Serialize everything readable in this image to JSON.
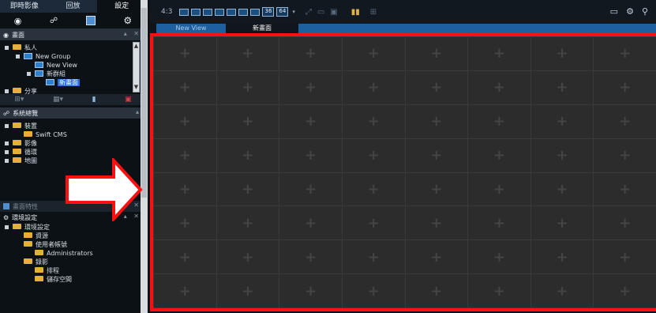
{
  "main_tabs": [
    "即時影像",
    "回放",
    "設定"
  ],
  "active_main_tab": 2,
  "view_section": {
    "title": "畫面"
  },
  "tree_views": [
    {
      "label": "私人",
      "type": "folder",
      "indent": 0
    },
    {
      "label": "New Group",
      "type": "group",
      "indent": 1
    },
    {
      "label": "New View",
      "type": "view",
      "indent": 2
    },
    {
      "label": "新群組",
      "type": "group",
      "indent": 2
    },
    {
      "label": "新畫面",
      "type": "view",
      "indent": 3,
      "selected": true
    },
    {
      "label": "分享",
      "type": "folder",
      "indent": 0
    }
  ],
  "system_section": {
    "title": "系統總覽"
  },
  "tree_system": [
    {
      "label": "裝置",
      "indent": 0
    },
    {
      "label": "Swift CMS",
      "indent": 1
    },
    {
      "label": "影像",
      "indent": 0
    },
    {
      "label": "循環",
      "indent": 0
    },
    {
      "label": "地圖",
      "indent": 0
    }
  ],
  "props_section": {
    "title": "畫面特性"
  },
  "settings_section": {
    "title": "環境設定"
  },
  "tree_settings": [
    {
      "label": "環境設定",
      "indent": 0
    },
    {
      "label": "資源",
      "indent": 1
    },
    {
      "label": "使用者帳號",
      "indent": 1
    },
    {
      "label": "Administrators",
      "indent": 2
    },
    {
      "label": "錄影",
      "indent": 1
    },
    {
      "label": "排程",
      "indent": 2
    },
    {
      "label": "儲存空間",
      "indent": 2
    }
  ],
  "toolbar": {
    "ratio": "4:3",
    "layout_36": "36",
    "layout_64": "64"
  },
  "view_tabs": [
    "New View",
    "新畫面"
  ],
  "grid": {
    "rows": 8,
    "cols": 8,
    "placeholder": "+"
  },
  "colors": {
    "highlight_border": "#ff1010",
    "selection": "#2a6fd0",
    "tab_blue": "#1e5f9f"
  }
}
